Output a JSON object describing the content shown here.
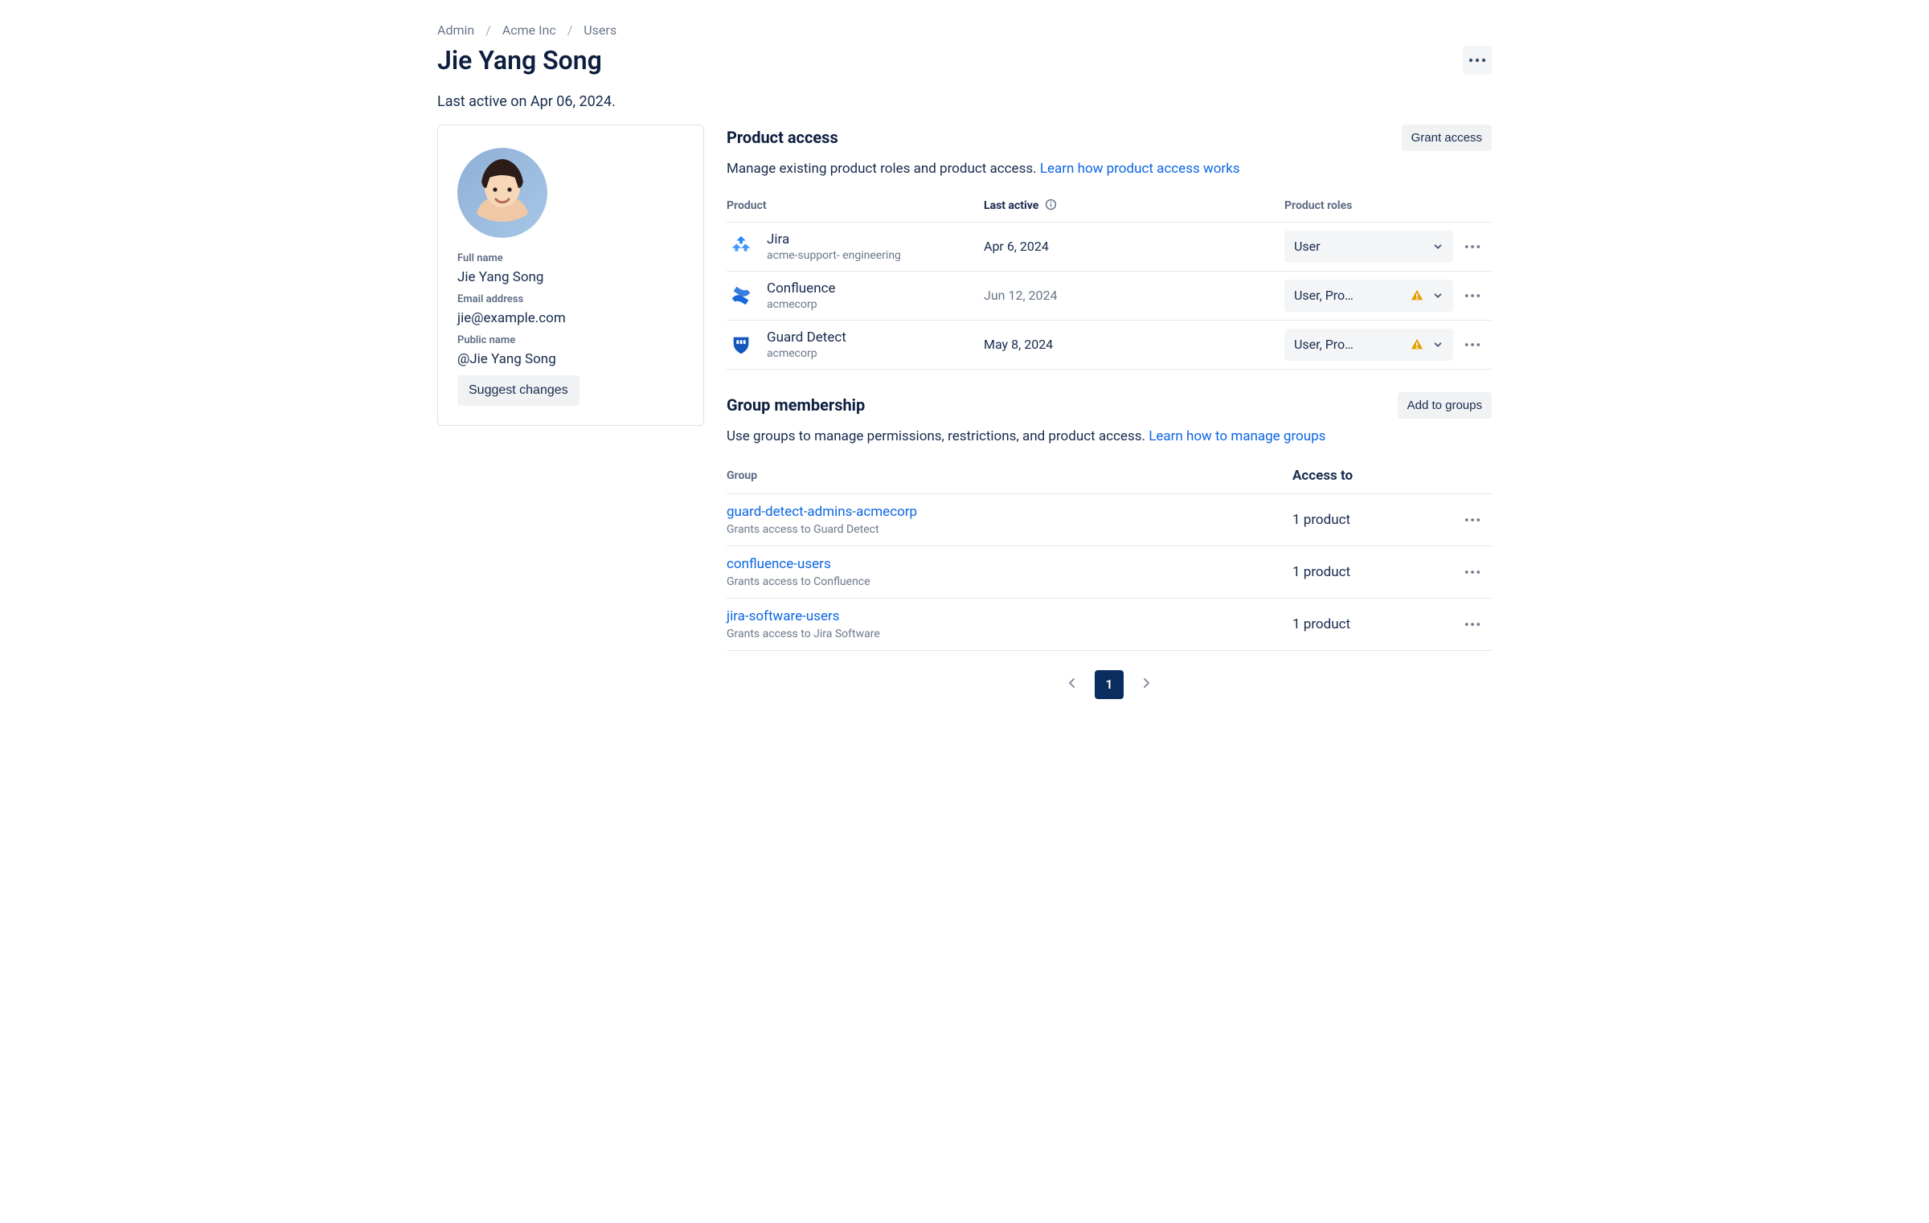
{
  "breadcrumb": [
    "Admin",
    "Acme Inc",
    "Users"
  ],
  "title": "Jie Yang Song",
  "last_active_text": "Last active on Apr 06, 2024.",
  "profile": {
    "full_name_label": "Full name",
    "full_name": "Jie Yang Song",
    "email_label": "Email address",
    "email": "jie@example.com",
    "public_name_label": "Public name",
    "public_name": "@Jie Yang Song",
    "suggest_changes": "Suggest changes"
  },
  "product_access": {
    "title": "Product access",
    "grant_button": "Grant access",
    "desc_prefix": "Manage existing product roles and product access. ",
    "desc_link": "Learn how product access works",
    "columns": {
      "product": "Product",
      "last_active": "Last active",
      "roles": "Product roles"
    },
    "rows": [
      {
        "icon": "jira",
        "name": "Jira",
        "org": "acme-support- engineering",
        "last_active": "Apr 6, 2024",
        "muted": false,
        "role": "User",
        "warn": false
      },
      {
        "icon": "confluence",
        "name": "Confluence",
        "org": "acmecorp",
        "last_active": "Jun 12, 2024",
        "muted": true,
        "role": "User, Pro…",
        "warn": true
      },
      {
        "icon": "guard",
        "name": "Guard Detect",
        "org": "acmecorp",
        "last_active": "May 8, 2024",
        "muted": false,
        "role": "User, Pro…",
        "warn": true
      }
    ]
  },
  "groups": {
    "title": "Group membership",
    "add_button": "Add to groups",
    "desc_prefix": "Use groups to manage permissions, restrictions, and product access. ",
    "desc_link": "Learn how to manage groups",
    "columns": {
      "group": "Group",
      "access": "Access to"
    },
    "rows": [
      {
        "name": "guard-detect-admins-acmecorp",
        "desc": "Grants access to Guard Detect",
        "access": "1 product"
      },
      {
        "name": "confluence-users",
        "desc": "Grants access to Confluence",
        "access": "1 product"
      },
      {
        "name": "jira-software-users",
        "desc": "Grants access to Jira Software",
        "access": "1 product"
      }
    ]
  },
  "pagination": {
    "current": "1"
  }
}
